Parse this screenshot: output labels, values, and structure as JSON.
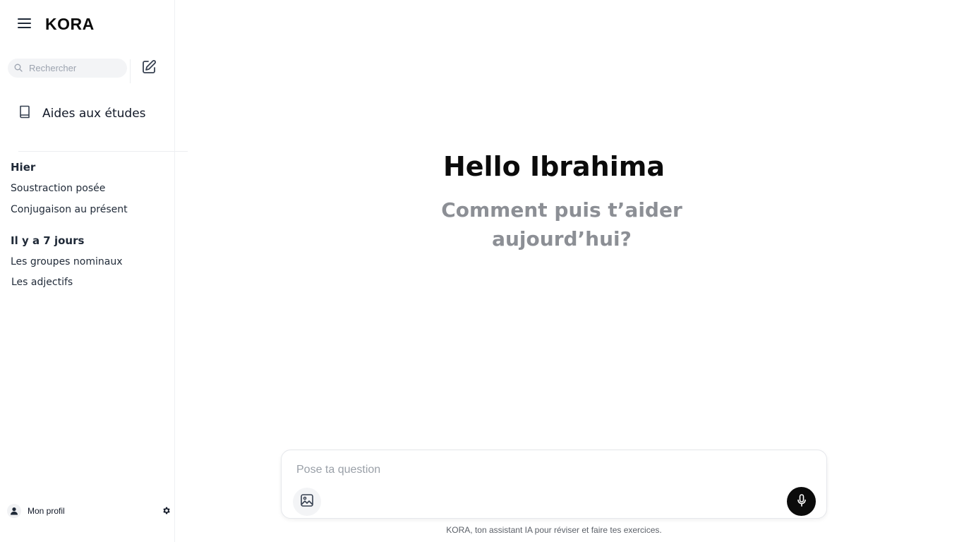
{
  "app": {
    "name": "KORA"
  },
  "sidebar": {
    "search_placeholder": "Rechercher",
    "study_aids_label": "Aides aux études",
    "sections": [
      {
        "title": "Hier",
        "items": [
          "Soustraction posée",
          "Conjugaison au présent"
        ]
      },
      {
        "title": "Il y a 7 jours",
        "items": [
          "Les groupes nominaux",
          "Les adjectifs"
        ]
      }
    ],
    "profile_label": "Mon profil"
  },
  "main": {
    "greeting": "Hello Ibrahima",
    "subtitle": "Comment puis t’aider aujourd’hui?",
    "input_placeholder": "Pose ta question",
    "footer_note": "KORA, ton assistant IA pour réviser et faire tes exercices."
  },
  "icons": {
    "menu": "menu-icon",
    "search": "search-icon",
    "new_chat": "edit-icon",
    "study_aids": "book-icon",
    "profile": "user-icon",
    "settings": "gear-icon",
    "image": "image-icon",
    "mic": "microphone-icon"
  },
  "colors": {
    "accent": "#0b0b0b",
    "muted_text": "#8c8f95",
    "search_bg": "#f3f4f6"
  }
}
